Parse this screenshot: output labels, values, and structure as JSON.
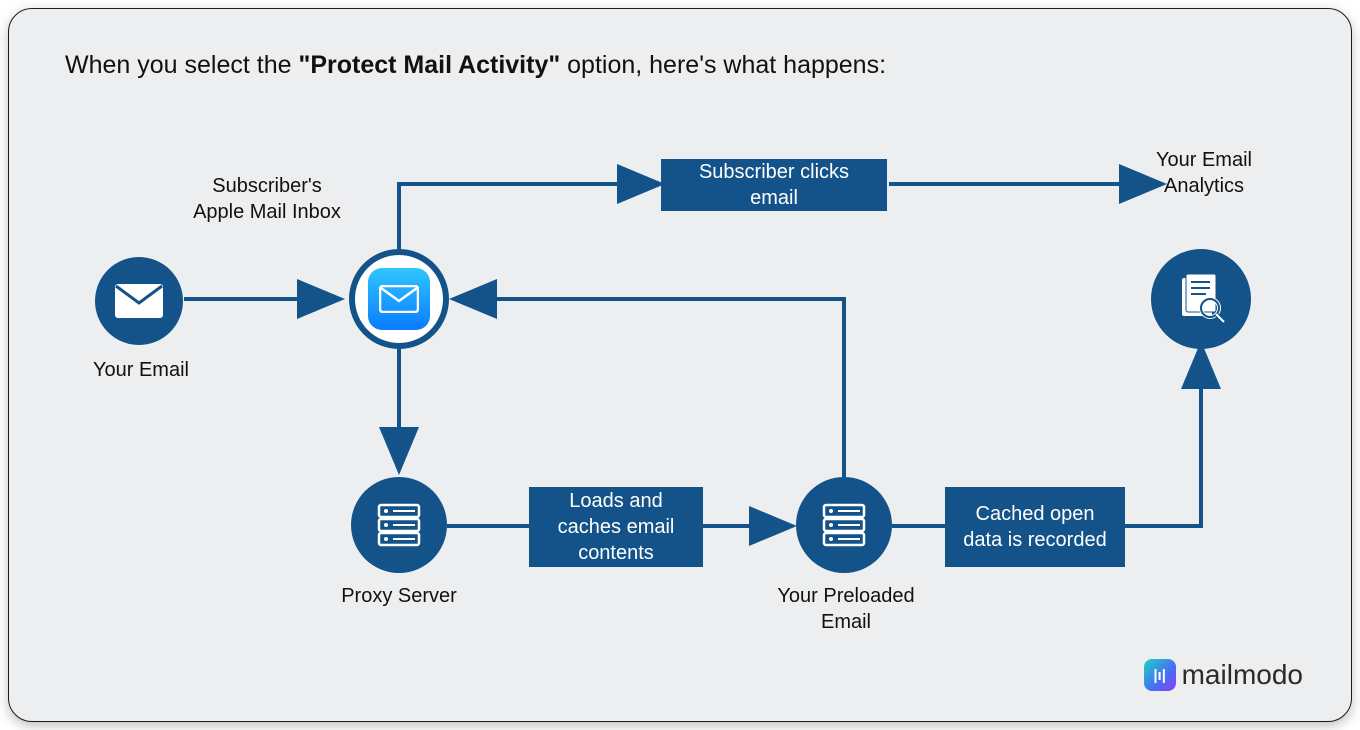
{
  "heading": {
    "prefix": "When you select the ",
    "bold": "\"Protect Mail Activity\"",
    "suffix": " option, here's what happens:"
  },
  "nodes": {
    "your_email": {
      "label": "Your Email"
    },
    "apple_inbox": {
      "label": "Subscriber's Apple Mail Inbox"
    },
    "proxy_server": {
      "label": "Proxy Server"
    },
    "preloaded_email": {
      "label": "Your Preloaded Email"
    },
    "analytics": {
      "label": "Your Email Analytics"
    }
  },
  "boxes": {
    "subscriber_clicks": "Subscriber clicks email",
    "loads_caches": "Loads and caches email contents",
    "cached_recorded": "Cached open data is recorded"
  },
  "brand": {
    "name": "mailmodo",
    "mark": "|ı|"
  },
  "colors": {
    "primary": "#13538a",
    "bg": "#edeeef"
  }
}
